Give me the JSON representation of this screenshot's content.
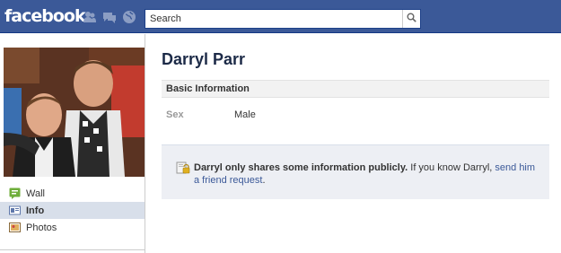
{
  "header": {
    "logo": "facebook",
    "search_placeholder": "Search",
    "icons": [
      "friend-requests-icon",
      "messages-icon",
      "notifications-globe-icon",
      "search-icon"
    ]
  },
  "sidebar": {
    "profile_picture": "profile-photo",
    "items": [
      {
        "label": "Wall",
        "icon": "wall-icon",
        "active": false
      },
      {
        "label": "Info",
        "icon": "info-icon",
        "active": true
      },
      {
        "label": "Photos",
        "icon": "photos-icon",
        "active": false
      }
    ]
  },
  "profile": {
    "name": "Darryl Parr",
    "basic_info_header": "Basic Information",
    "fields": [
      {
        "label": "Sex",
        "value": "Male"
      }
    ]
  },
  "notice": {
    "icon": "lock-icon",
    "bold_text": "Darryl only shares some information publicly.",
    "text": " If you know Darryl, ",
    "link_text": "send him a friend request",
    "end_text": "."
  },
  "colors": {
    "brand_blue": "#3b5998",
    "nav_active": "#d8dfea",
    "notice_bg": "#edeff4"
  }
}
